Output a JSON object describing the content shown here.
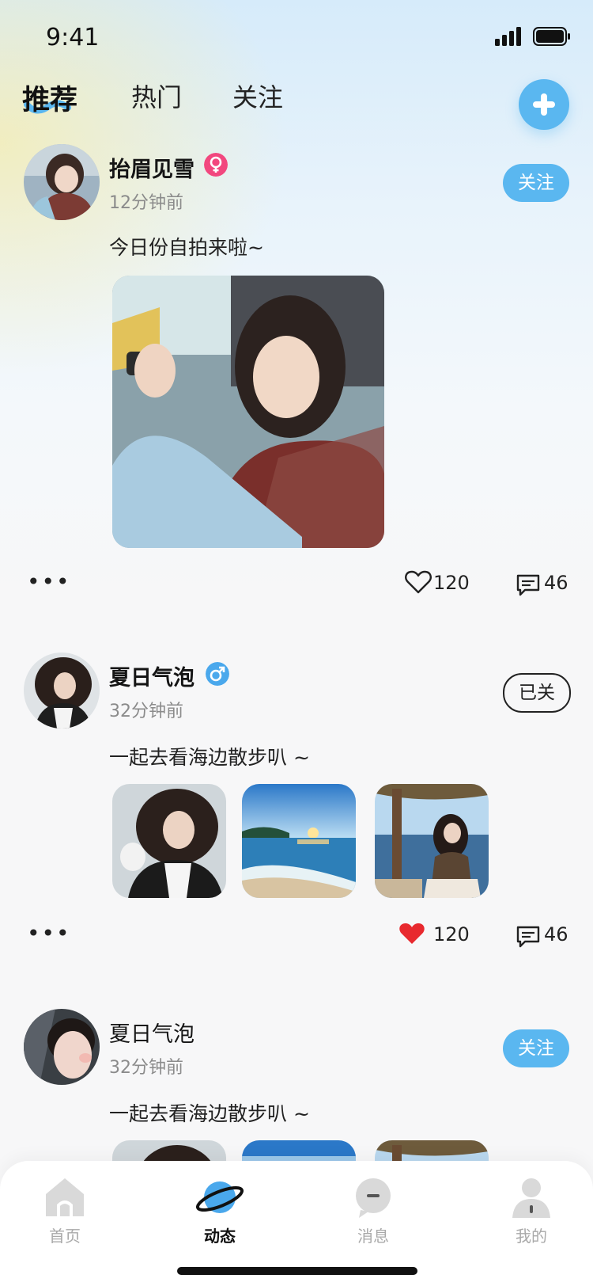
{
  "status_bar": {
    "time": "9:41"
  },
  "top_tabs": [
    {
      "label": "推荐",
      "active": true
    },
    {
      "label": "热门",
      "active": false
    },
    {
      "label": "关注",
      "active": false
    }
  ],
  "posts": [
    {
      "username": "抬眉见雪",
      "gender": "female",
      "time": "12分钟前",
      "caption": "今日份自拍来啦~",
      "follow_label": "关注",
      "like_count": "120",
      "liked": false,
      "comment_count": "46",
      "photo_count": 1
    },
    {
      "username": "夏日气泡",
      "gender": "male",
      "time": "32分钟前",
      "caption": "一起去看海边散步叭 ~",
      "follow_label": "已关",
      "like_count": "120",
      "liked": true,
      "comment_count": "46",
      "photo_count": 3
    },
    {
      "username": "夏日气泡",
      "gender": "none",
      "time": "32分钟前",
      "caption": "一起去看海边散步叭 ~",
      "follow_label": "关注",
      "photo_count": 3
    }
  ],
  "more_glyph": "•••",
  "bottom_nav": [
    {
      "label": "首页",
      "icon": "home-icon",
      "active": false
    },
    {
      "label": "动态",
      "icon": "planet-icon",
      "active": true
    },
    {
      "label": "消息",
      "icon": "message-icon",
      "active": false
    },
    {
      "label": "我的",
      "icon": "profile-icon",
      "active": false
    }
  ],
  "colors": {
    "accent": "#5ab7f0",
    "female": "#f2477e",
    "male": "#4aa8ec",
    "like_active": "#e8292e"
  }
}
